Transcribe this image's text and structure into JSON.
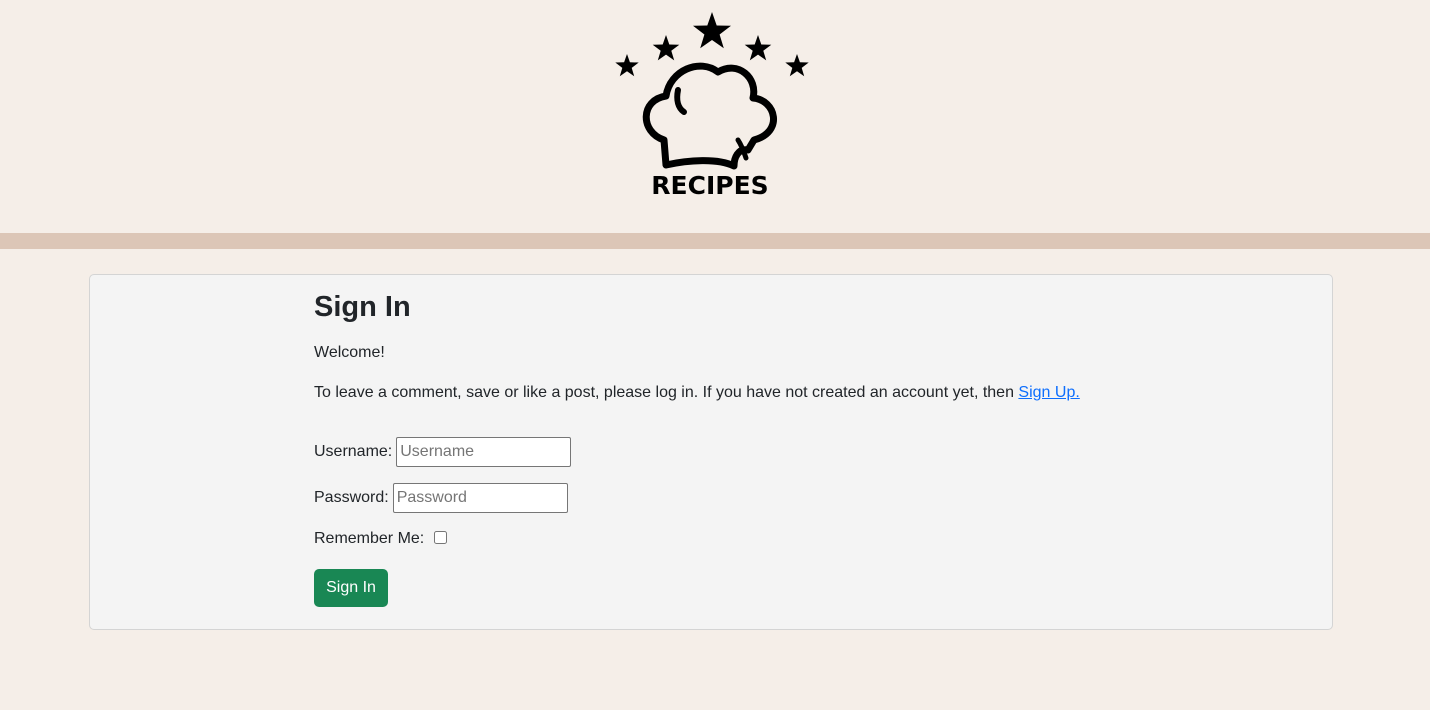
{
  "brand": {
    "logo_text": "RECIPES",
    "colors": {
      "background": "#f5eee8",
      "strip": "#dcc6b7",
      "logo": "#000000"
    }
  },
  "signin": {
    "title": "Sign In",
    "welcome": "Welcome!",
    "intro_text": "To leave a comment, save or like a post, please log in. If you have not created an account yet, then ",
    "signup_link": "Sign Up.",
    "username_label": "Username:",
    "username_placeholder": "Username",
    "username_value": "",
    "password_label": "Password:",
    "password_placeholder": "Password",
    "password_value": "",
    "remember_label": "Remember Me:",
    "remember_checked": false,
    "button_label": "Sign In",
    "colors": {
      "button": "#198754",
      "link": "#0d6efd",
      "card": "#f4f4f4"
    }
  }
}
